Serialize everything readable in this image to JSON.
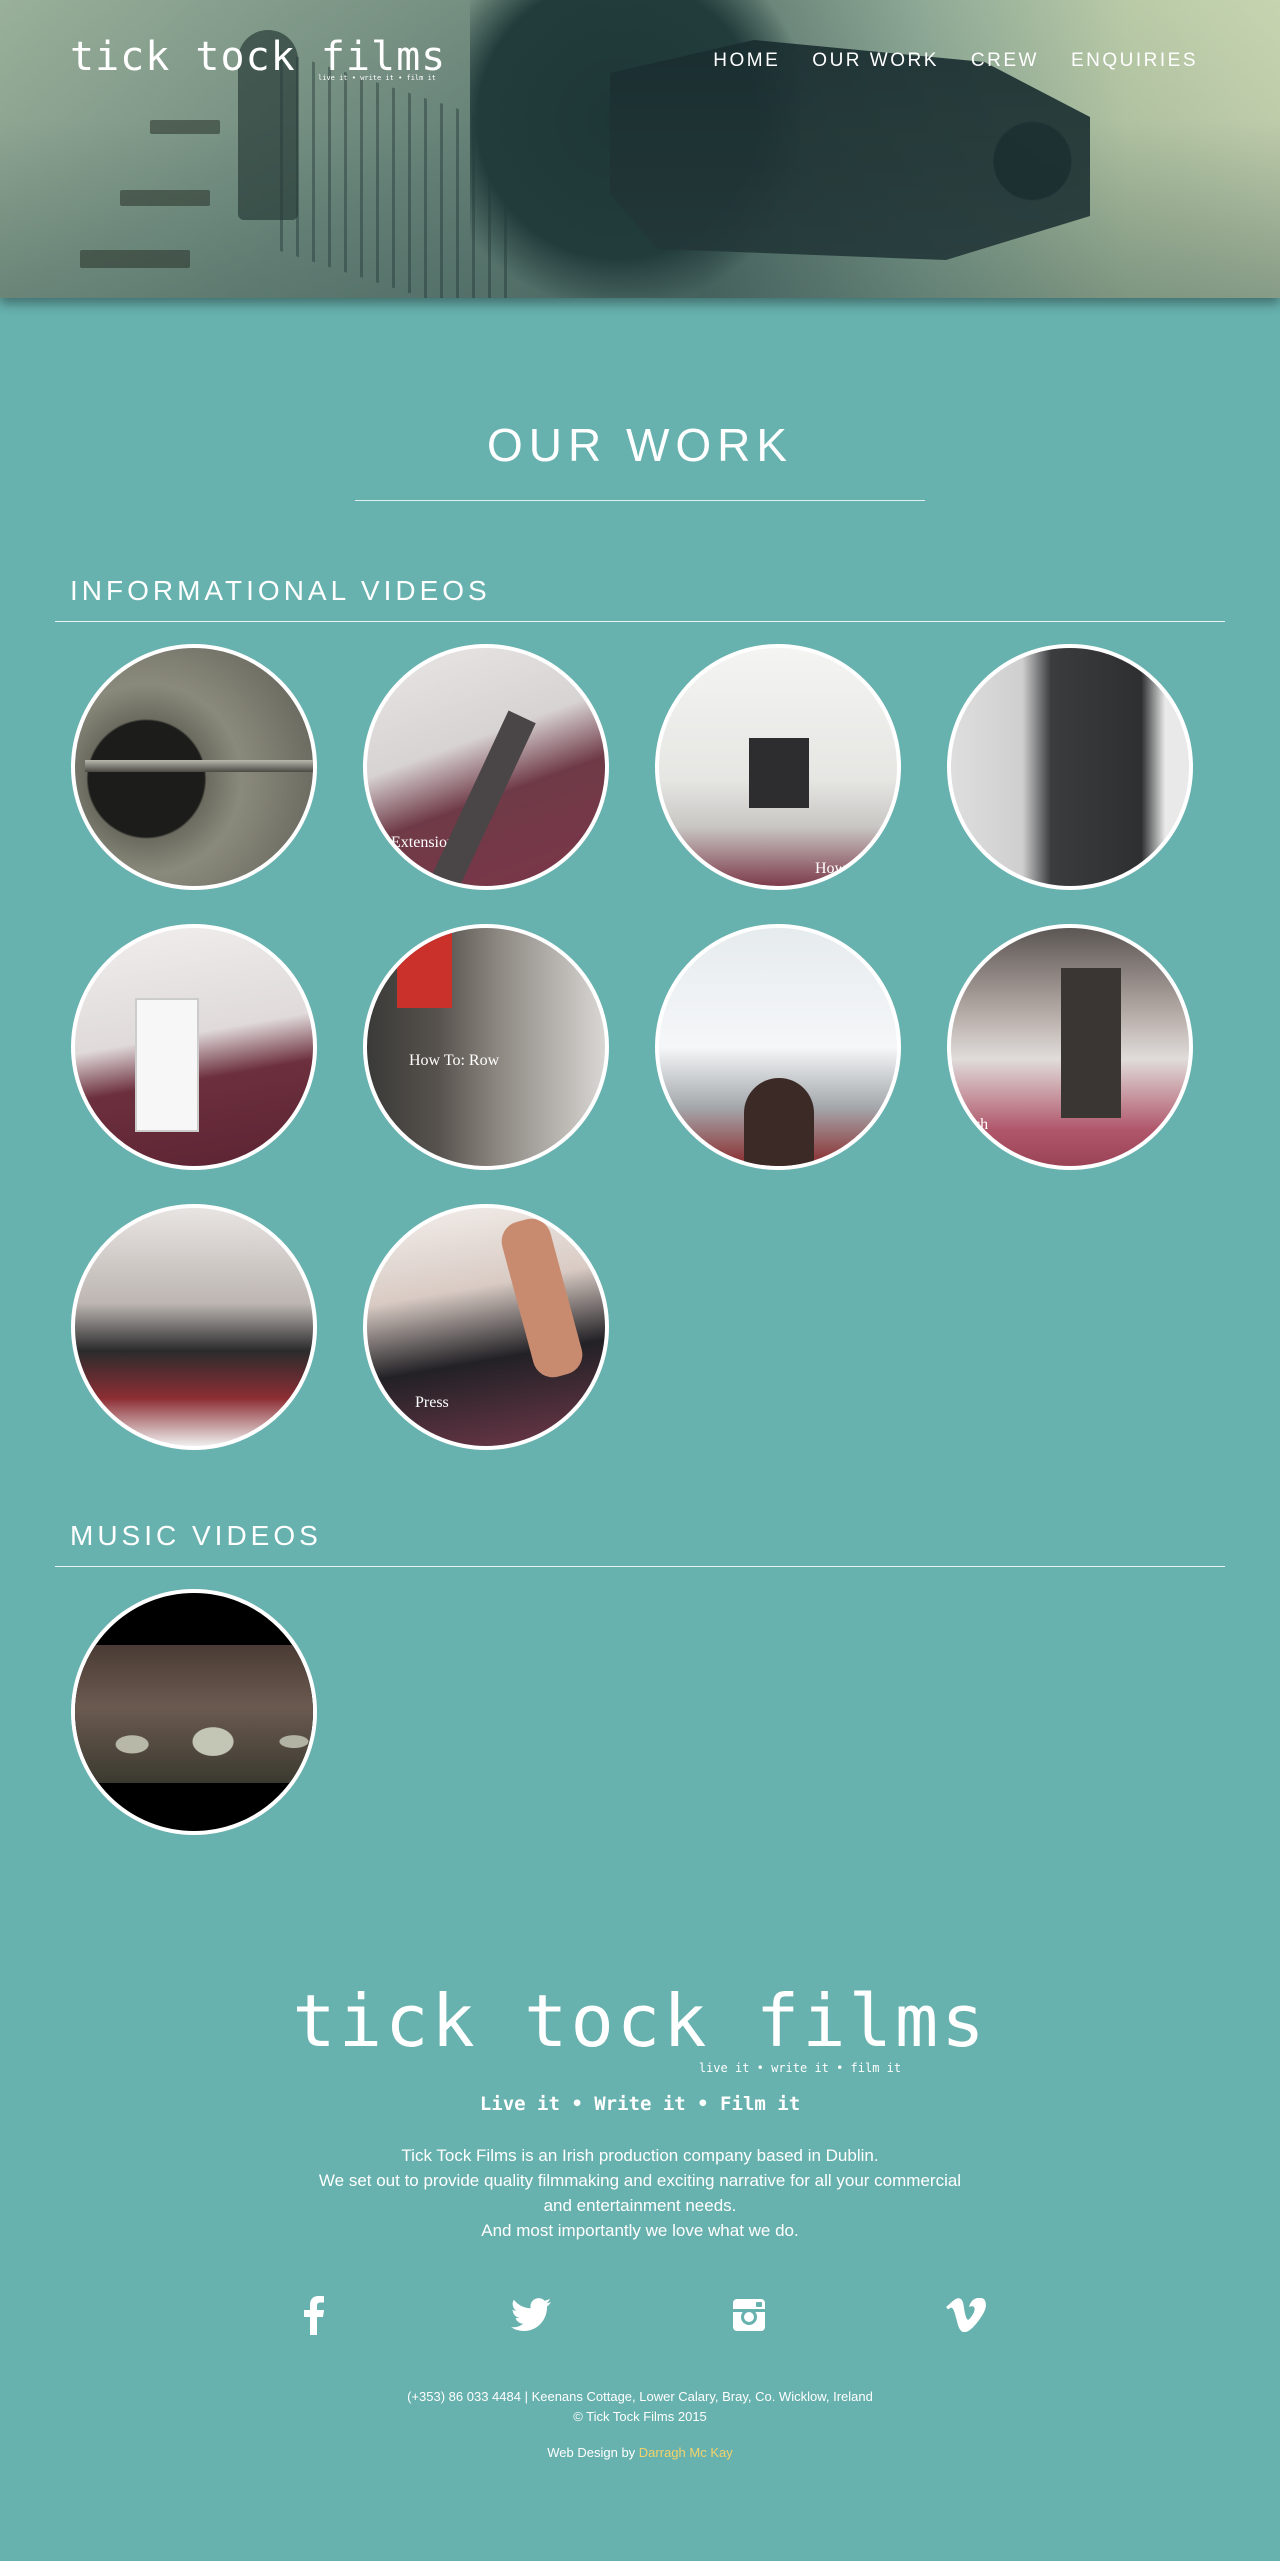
{
  "header": {
    "logo": "tick tock films",
    "logo_tagline": "live it • write it • film it",
    "nav": [
      "HOME",
      "OUR WORK",
      "CREW",
      "ENQUIRIES"
    ]
  },
  "main": {
    "title": "OUR WORK",
    "sections": [
      {
        "heading": "INFORMATIONAL VIDEOS",
        "captions": [
          "",
          "Extension",
          "How",
          "",
          "",
          "How To: Row",
          "",
          "nch",
          "",
          "Press"
        ]
      },
      {
        "heading": "MUSIC VIDEOS"
      }
    ]
  },
  "footer": {
    "logo": "tick tock films",
    "logo_tagline": "live it • write it • film it",
    "slogan": "Live it • Write it • Film it",
    "about": [
      "Tick Tock Films is an Irish production company based in Dublin.",
      "We set out to provide quality filmmaking and exciting narrative for all your commercial",
      "and entertainment needs.",
      "And most importantly we love what we do."
    ],
    "social": [
      "facebook-icon",
      "twitter-icon",
      "instagram-icon",
      "vimeo-icon"
    ],
    "contact": "(+353) 86 033 4484 | Keenans Cottage, Lower Calary, Bray, Co. Wicklow, Ireland",
    "copyright": "© Tick Tock Films 2015",
    "credit_prefix": "Web Design by ",
    "credit_name": "Darragh Mc Kay",
    "credit_color": "#f3d36b"
  },
  "colors": {
    "background": "#67b1ae",
    "text": "#ffffff"
  }
}
